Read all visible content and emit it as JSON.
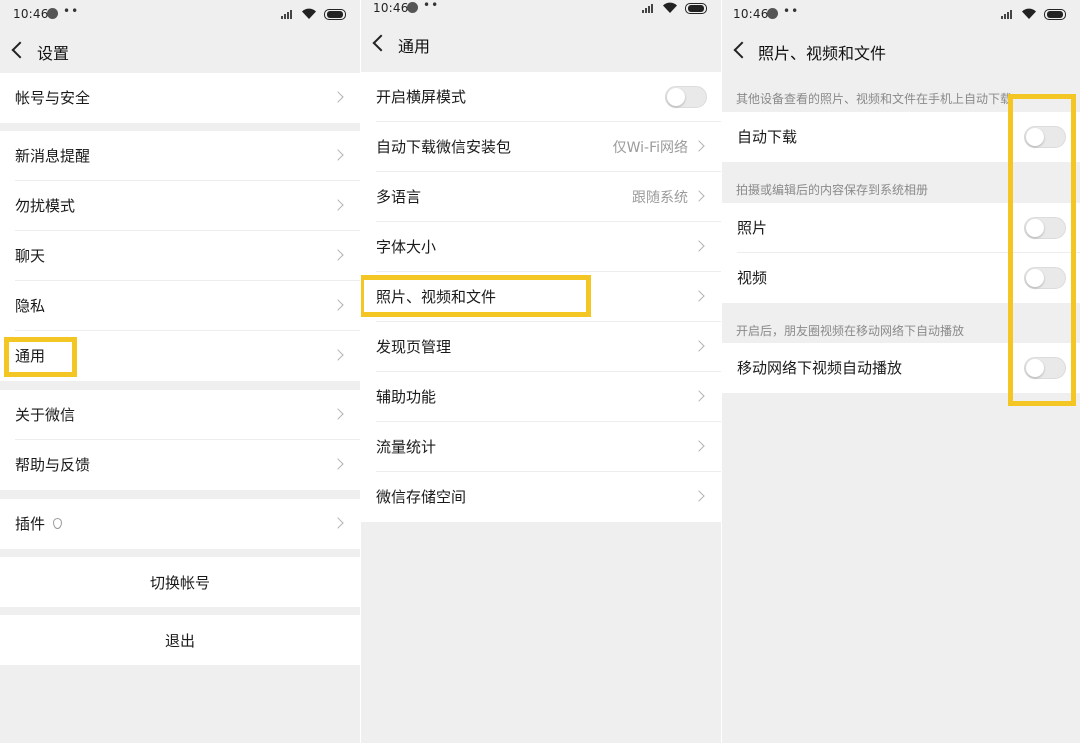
{
  "statusbar": {
    "time": "10:46",
    "dots": "••"
  },
  "panel1": {
    "title": "设置",
    "items": [
      {
        "label": "帐号与安全"
      },
      {
        "label": "新消息提醒"
      },
      {
        "label": "勿扰模式"
      },
      {
        "label": "聊天"
      },
      {
        "label": "隐私"
      },
      {
        "label": "通用"
      },
      {
        "label": "关于微信"
      },
      {
        "label": "帮助与反馈"
      },
      {
        "label": "插件"
      }
    ],
    "switch_account": "切换帐号",
    "logout": "退出"
  },
  "panel2": {
    "title": "通用",
    "items": [
      {
        "label": "开启横屏模式",
        "toggle": false
      },
      {
        "label": "自动下载微信安装包",
        "value": "仅Wi-Fi网络"
      },
      {
        "label": "多语言",
        "value": "跟随系统"
      },
      {
        "label": "字体大小"
      },
      {
        "label": "照片、视频和文件"
      },
      {
        "label": "发现页管理"
      },
      {
        "label": "辅助功能"
      },
      {
        "label": "流量统计"
      },
      {
        "label": "微信存储空间"
      }
    ]
  },
  "panel3": {
    "title": "照片、视频和文件",
    "notes": [
      "其他设备查看的照片、视频和文件在手机上自动下载",
      "拍摄或编辑后的内容保存到系统相册",
      "开启后，朋友圈视频在移动网络下自动播放"
    ],
    "items": [
      {
        "label": "自动下载",
        "toggle": false
      },
      {
        "label": "照片",
        "toggle": false
      },
      {
        "label": "视频",
        "toggle": false
      },
      {
        "label": "移动网络下视频自动播放",
        "toggle": false
      }
    ]
  },
  "colors": {
    "highlight": "#f3c623",
    "background": "#efefef"
  },
  "icons": [
    "back-icon",
    "chevron-right-icon",
    "wifi-icon",
    "battery-icon",
    "signal-icon",
    "plugin-icon",
    "toggle-switch"
  ]
}
